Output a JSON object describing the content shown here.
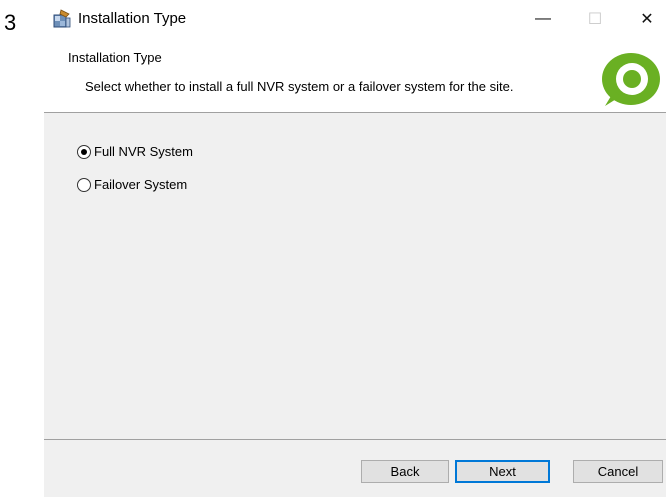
{
  "step_number": "3",
  "window": {
    "title": "Installation Type",
    "controls": {
      "minimize": "—",
      "maximize": "☐",
      "close": "✕"
    }
  },
  "header": {
    "title": "Installation Type",
    "description": "Select whether to install a full NVR system or a failover system for the site.",
    "logo_icon": "eye-logo-icon",
    "logo_color": "#6ab023"
  },
  "options": [
    {
      "label": "Full NVR System",
      "selected": true
    },
    {
      "label": "Failover System",
      "selected": false
    }
  ],
  "footer": {
    "back_label": "Back",
    "next_label": "Next",
    "cancel_label": "Cancel"
  },
  "colors": {
    "panel_bg": "#f0f0f0",
    "button_bg": "#e1e1e1",
    "focus_border": "#0078d7"
  }
}
